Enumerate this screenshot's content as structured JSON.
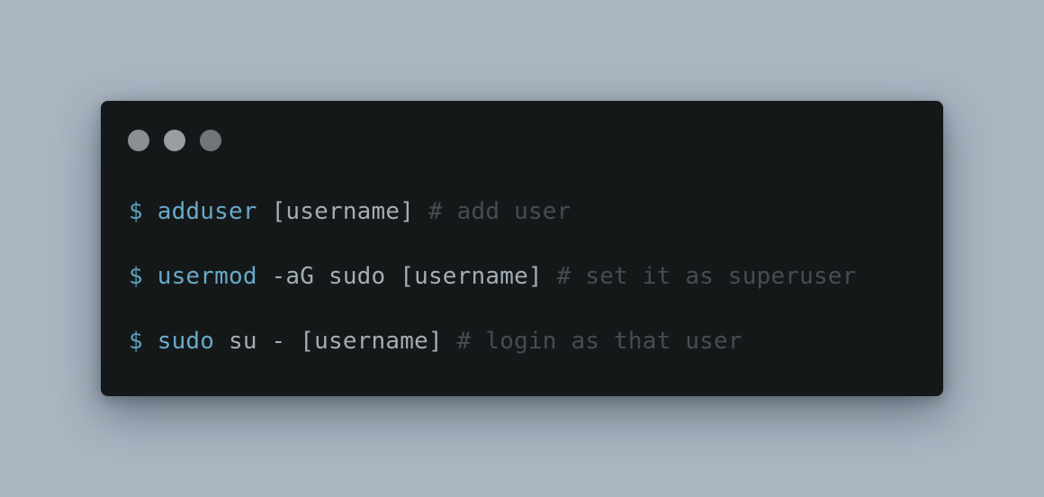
{
  "colors": {
    "background": "#aab5c2",
    "terminal_bg": "#151819",
    "dot_1": "#8a8f93",
    "dot_2": "#9a9ea2",
    "dot_3": "#6f7579"
  },
  "window": {
    "dots": [
      {
        "icon": "window-dot-1-icon"
      },
      {
        "icon": "window-dot-2-icon"
      },
      {
        "icon": "window-dot-3-icon"
      }
    ]
  },
  "lines": [
    {
      "prompt": "$",
      "command": "adduser",
      "args": "[username]",
      "comment": "# add user"
    },
    {
      "prompt": "$",
      "command": "usermod",
      "args": "-aG sudo [username]",
      "comment": "# set it as superuser"
    },
    {
      "prompt": "$",
      "command": "sudo",
      "args": "su - [username]",
      "comment": "# login as that user"
    }
  ]
}
